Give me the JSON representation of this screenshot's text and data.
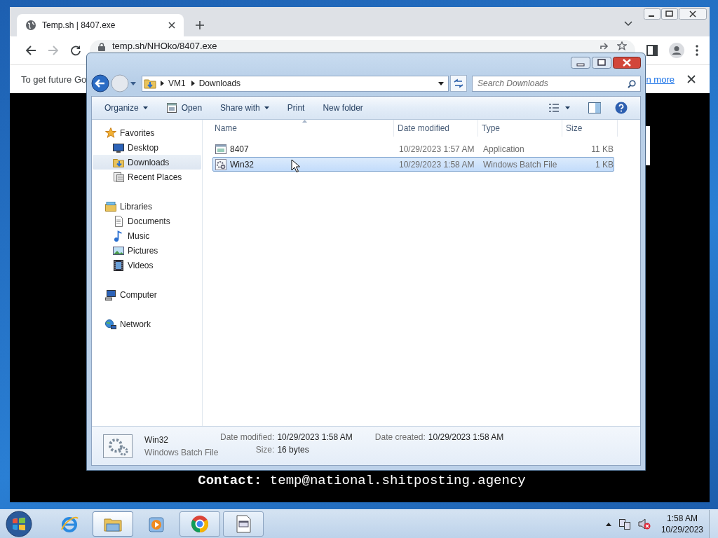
{
  "browser": {
    "tab": {
      "title": "Temp.sh | 8407.exe"
    },
    "forward_disabled": true,
    "address": "temp.sh/NHOko/8407.exe",
    "infobar": {
      "text": "To get future Go",
      "link": "n more"
    },
    "content": {
      "contact_label": "Contact:",
      "contact_email": "temp@national.shitposting.agency"
    }
  },
  "explorer": {
    "forward_disabled": true,
    "breadcrumb": [
      "VM1",
      "Downloads"
    ],
    "search": {
      "placeholder": "Search Downloads"
    },
    "toolbar": [
      {
        "label": "Organize",
        "kind": "dropdown"
      },
      {
        "label": "Open",
        "kind": "with-icon"
      },
      {
        "label": "Share with",
        "kind": "dropdown"
      },
      {
        "label": "Print",
        "kind": "plain"
      },
      {
        "label": "New folder",
        "kind": "plain"
      }
    ],
    "nav": [
      {
        "label": "Favorites",
        "kind": "favorites",
        "selected": false,
        "children": [
          {
            "label": "Desktop",
            "kind": "desktop",
            "selected": false
          },
          {
            "label": "Downloads",
            "kind": "downloads",
            "selected": true
          },
          {
            "label": "Recent Places",
            "kind": "recent",
            "selected": false
          }
        ]
      },
      {
        "label": "Libraries",
        "kind": "libraries",
        "selected": false,
        "children": [
          {
            "label": "Documents",
            "kind": "documents",
            "selected": false
          },
          {
            "label": "Music",
            "kind": "music",
            "selected": false
          },
          {
            "label": "Pictures",
            "kind": "pictures",
            "selected": false
          },
          {
            "label": "Videos",
            "kind": "videos",
            "selected": false
          }
        ]
      },
      {
        "label": "Computer",
        "kind": "computer",
        "selected": false
      },
      {
        "label": "Network",
        "kind": "network",
        "selected": false
      }
    ],
    "columns": [
      {
        "label": "Name",
        "sorted": true
      },
      {
        "label": "Date modified",
        "sorted": false
      },
      {
        "label": "Type",
        "sorted": false
      },
      {
        "label": "Size",
        "sorted": false
      }
    ],
    "files": [
      {
        "name": "8407",
        "date": "10/29/2023 1:57 AM",
        "type": "Application",
        "size": "11 KB",
        "kind": "application",
        "selected": false
      },
      {
        "name": "Win32",
        "date": "10/29/2023 1:58 AM",
        "type": "Windows Batch File",
        "size": "1 KB",
        "kind": "batch",
        "selected": true
      }
    ],
    "details": {
      "name": "Win32",
      "type": "Windows Batch File",
      "field_columns": [
        [
          {
            "label": "Date modified:",
            "value": "10/29/2023 1:58 AM"
          },
          {
            "label": "Size:",
            "value": "16 bytes"
          }
        ],
        [
          {
            "label": "Date created:",
            "value": "10/29/2023 1:58 AM"
          }
        ]
      ]
    }
  },
  "taskbar": {
    "apps": [
      {
        "kind": "ie",
        "running": false,
        "active": false
      },
      {
        "kind": "explorer",
        "running": true,
        "active": true
      },
      {
        "kind": "media",
        "running": false,
        "active": false
      },
      {
        "kind": "chrome",
        "running": true,
        "active": false
      },
      {
        "kind": "window",
        "running": true,
        "active": false
      }
    ],
    "volume_muted": true,
    "clock": {
      "time": "1:58 AM",
      "date": "10/29/2023"
    }
  }
}
